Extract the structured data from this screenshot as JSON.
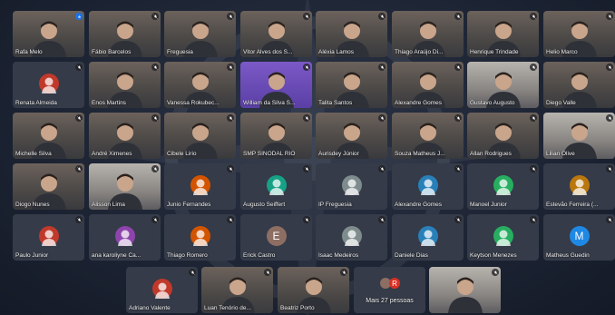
{
  "participants": [
    {
      "name": "Rafa Melo",
      "type": "video",
      "mic": "blue"
    },
    {
      "name": "Fábio Barcelos",
      "type": "video",
      "mic": "muted"
    },
    {
      "name": "Freguesia",
      "type": "video",
      "mic": "muted"
    },
    {
      "name": "Vitor Alves dos S...",
      "type": "video",
      "mic": "muted"
    },
    {
      "name": "Aléxia Lamos",
      "type": "video",
      "mic": "muted"
    },
    {
      "name": "Thiago Araújo Di...",
      "type": "video",
      "mic": "muted"
    },
    {
      "name": "Henrique Trindade",
      "type": "video",
      "mic": "muted"
    },
    {
      "name": "Helio Marco",
      "type": "video",
      "mic": "muted"
    },
    {
      "name": "Renata Almeida",
      "type": "avatar",
      "mic": "muted"
    },
    {
      "name": "Enos Martins",
      "type": "video",
      "mic": "muted"
    },
    {
      "name": "Vanessa Rokubec...",
      "type": "video",
      "mic": "muted"
    },
    {
      "name": "William da Silva S...",
      "type": "video-purple",
      "mic": "muted"
    },
    {
      "name": "Talita Santos",
      "type": "video",
      "mic": "muted"
    },
    {
      "name": "Alexandre Gomes",
      "type": "video",
      "mic": "muted"
    },
    {
      "name": "Gustavo Augusto",
      "type": "video-light",
      "mic": "muted"
    },
    {
      "name": "Diego Valle",
      "type": "video",
      "mic": "muted"
    },
    {
      "name": "Michelle Silva",
      "type": "video",
      "mic": "muted"
    },
    {
      "name": "André Ximenes",
      "type": "video",
      "mic": "muted"
    },
    {
      "name": "Cibele Lirio",
      "type": "video",
      "mic": "muted"
    },
    {
      "name": "SMP SINODAL RIO",
      "type": "video",
      "mic": "muted"
    },
    {
      "name": "Aurisdey Júnior",
      "type": "video",
      "mic": "muted"
    },
    {
      "name": "Souza Matheus J...",
      "type": "video",
      "mic": "muted"
    },
    {
      "name": "Allan Rodrigues",
      "type": "video",
      "mic": "muted"
    },
    {
      "name": "Lilian Olive",
      "type": "video-light",
      "mic": "muted"
    },
    {
      "name": "Diogo Nunes",
      "type": "video",
      "mic": "muted"
    },
    {
      "name": "Alisson Lima",
      "type": "video-light",
      "mic": "muted"
    },
    {
      "name": "Junio Fernandes",
      "type": "avatar",
      "mic": "muted"
    },
    {
      "name": "Augusto Seiffert",
      "type": "avatar",
      "mic": "muted"
    },
    {
      "name": "IP Freguesia",
      "type": "avatar",
      "mic": "muted"
    },
    {
      "name": "Alexandre Gomes",
      "type": "avatar",
      "mic": "muted"
    },
    {
      "name": "Manoel Junior",
      "type": "avatar",
      "mic": "muted"
    },
    {
      "name": "Estevão Ferreira (...",
      "type": "avatar",
      "mic": "muted"
    },
    {
      "name": "Paulo Junior",
      "type": "avatar",
      "mic": "muted"
    },
    {
      "name": "ana karoliyne Ca...",
      "type": "avatar",
      "mic": "muted"
    },
    {
      "name": "Thiago Romero",
      "type": "avatar",
      "mic": "muted"
    },
    {
      "name": "Erick Castro",
      "type": "letter",
      "letter": "E",
      "mic": "muted"
    },
    {
      "name": "Isaac Medeiros",
      "type": "avatar",
      "mic": "muted"
    },
    {
      "name": "Daniele Dias",
      "type": "avatar",
      "mic": "muted"
    },
    {
      "name": "Keytson Menezes",
      "type": "avatar",
      "mic": "muted"
    },
    {
      "name": "Matheus Guedin",
      "type": "letter",
      "letter": "M",
      "mic": "muted"
    },
    {
      "name": "Adriano Valente",
      "type": "avatar",
      "mic": "muted"
    },
    {
      "name": "Luan Tenório de...",
      "type": "video",
      "mic": "muted"
    },
    {
      "name": "Beatriz Porto",
      "type": "video",
      "mic": "muted"
    },
    {
      "name": "Mais 27 pessoas",
      "type": "more",
      "mic": "none"
    },
    {
      "name": "",
      "type": "video-light",
      "mic": "muted"
    }
  ],
  "colors": {
    "avatar_palette": [
      "#c0392b",
      "#8e44ad",
      "#d35400",
      "#16a085",
      "#7f8c8d",
      "#2980b9",
      "#27ae60",
      "#b9770e"
    ],
    "letter_E": "#8d6e63",
    "letter_M": "#1e88e5",
    "more_badge": "#d93025"
  },
  "icons": {
    "mic_off": "mic-off-icon",
    "mic_on": "mic-on-icon"
  }
}
